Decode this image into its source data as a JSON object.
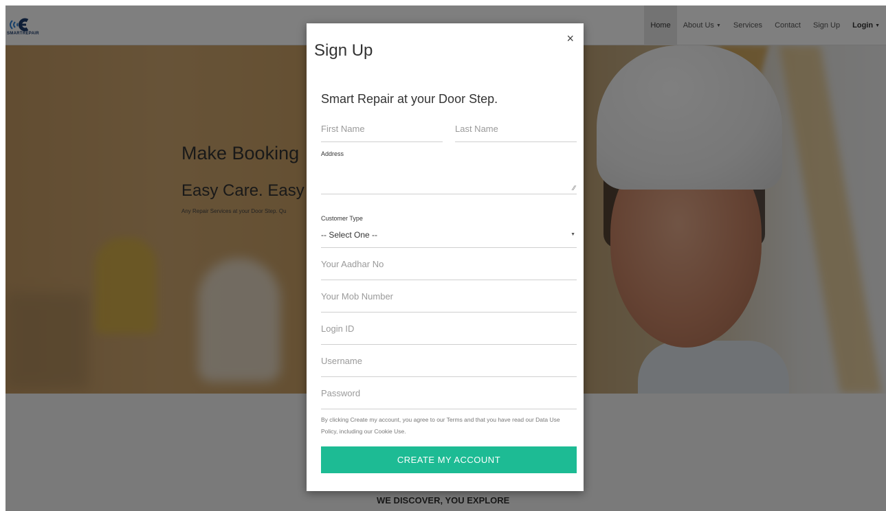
{
  "brand": {
    "logo_text": "SMARTREPAIR",
    "accent_color": "#1dbb94"
  },
  "nav": {
    "items": [
      {
        "label": "Home",
        "active": true
      },
      {
        "label": "About Us",
        "dropdown": true
      },
      {
        "label": "Services"
      },
      {
        "label": "Contact"
      },
      {
        "label": "Sign Up"
      },
      {
        "label": "Login",
        "dropdown": true
      }
    ]
  },
  "hero": {
    "heading": "Make Booking",
    "subheading": "Easy Care. Easy I",
    "text": "Any Repair Services at your Door Step. Qu"
  },
  "footer": {
    "tagline": "WE DISCOVER, YOU EXPLORE"
  },
  "modal": {
    "title": "Sign Up",
    "close_glyph": "×",
    "subtitle": "Smart Repair at your Door Step.",
    "fields": {
      "first_name_placeholder": "First Name",
      "last_name_placeholder": "Last Name",
      "address_label": "Address",
      "customer_type_label": "Customer Type",
      "customer_type_value": "-- Select One --",
      "aadhar_placeholder": "Your Aadhar No",
      "mobile_placeholder": "Your Mob Number",
      "login_id_placeholder": "Login ID",
      "username_placeholder": "Username",
      "password_placeholder": "Password"
    },
    "terms": "By clicking Create my account, you agree to our Terms and that you have read our Data Use Policy, including our Cookie Use.",
    "submit_label": "CREATE MY ACCOUNT"
  }
}
